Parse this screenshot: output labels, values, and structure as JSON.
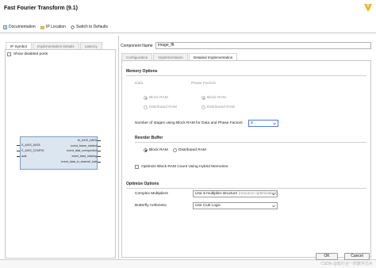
{
  "window": {
    "title": "Fast Fourier Transform (9.1)"
  },
  "toolbar": {
    "documentation": "Documentation",
    "ip_location": "IP Location",
    "switch_defaults": "Switch to Defaults"
  },
  "left": {
    "tabs": [
      "IP Symbol",
      "Implementation Details",
      "Latency"
    ],
    "show_disabled_ports": "Show disabled ports",
    "ports_left": [
      "S_AXIS_DATA",
      "S_AXIS_CONFIG",
      "aclk"
    ],
    "ports_right": [
      "M_AXIS_DATA",
      "event_frame_started",
      "event_tlast_unexpected",
      "event_tlast_missing",
      "event_data_in_channel_halt"
    ]
  },
  "component": {
    "label": "Component Name",
    "value": "image_fft"
  },
  "right": {
    "tabs": [
      "Configuration",
      "Implementation",
      "Detailed Implementation"
    ],
    "memory": {
      "title": "Memory Options",
      "data_label": "Data",
      "phase_label": "Phase Factors",
      "data_options": [
        "Block RAM",
        "Distributed RAM"
      ],
      "phase_options": [
        "Block RAM",
        "Distributed RAM"
      ],
      "stages_label": "Number of stages using Block RAM for Data and Phase Factors",
      "stages_value": "3"
    },
    "reorder": {
      "title": "Reorder Buffer",
      "options": [
        "Block RAM",
        "Distributed RAM"
      ],
      "hybrid_label": "Optimize Block RAM Count Using Hybrid Memories"
    },
    "optimize": {
      "title": "Optimize Options",
      "complex_label": "Complex Multipliers",
      "complex_value": "Use 3-multiplier structure",
      "complex_hint": "(resource optimization)",
      "butterfly_label": "Butterfly Arithmetic",
      "butterfly_value": "Use CLB Logic"
    }
  },
  "buttons": {
    "ok": "OK",
    "cancel": "Cancel"
  },
  "watermark": "CSDN @知行合一的数字芯片",
  "colors": {
    "accent": "#4a7fd0",
    "ip_block": "#dce6f1",
    "logo_yellow": "#f2b300"
  }
}
